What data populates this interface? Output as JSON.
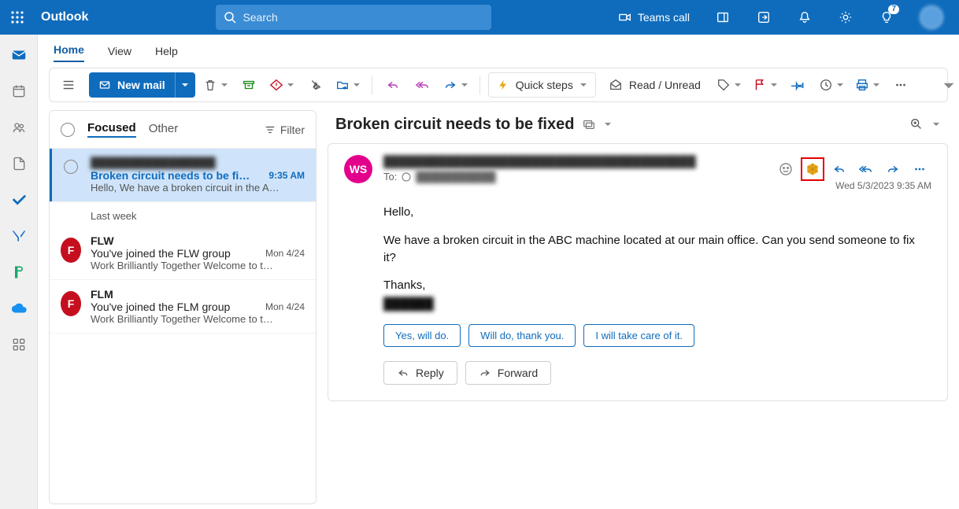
{
  "topbar": {
    "brand": "Outlook",
    "search_placeholder": "Search",
    "teams_call": "Teams call",
    "tip_badge": "7"
  },
  "menutabs": {
    "home": "Home",
    "view": "View",
    "help": "Help"
  },
  "ribbon": {
    "new_mail": "New mail",
    "quick_steps": "Quick steps",
    "read_unread": "Read / Unread"
  },
  "list": {
    "tab_focused": "Focused",
    "tab_other": "Other",
    "filter": "Filter",
    "group_lastweek": "Last week",
    "items": [
      {
        "from": "████████████████",
        "subject": "Broken circuit needs to be fi…",
        "time": "9:35 AM",
        "preview": "Hello, We have a broken circuit in the A…"
      },
      {
        "avatar": "F",
        "from": "FLW",
        "subject": "You've joined the FLW group",
        "time": "Mon 4/24",
        "preview": "Work Brilliantly Together Welcome to t…"
      },
      {
        "avatar": "F",
        "from": "FLM",
        "subject": "You've joined the FLM group",
        "time": "Mon 4/24",
        "preview": "Work Brilliantly Together Welcome to t…"
      }
    ]
  },
  "reading": {
    "subject": "Broken circuit needs to be fixed",
    "avatar_initials": "WS",
    "from_line": "████████████████████████████████████████",
    "to_label": "To:",
    "to_value": "███████████",
    "datetime": "Wed 5/3/2023 9:35 AM",
    "body_p1": "Hello,",
    "body_p2": "We have a broken circuit in the ABC machine located at   our main office. Can you send someone to fix it?",
    "body_p3": "Thanks,",
    "body_sig": "██████",
    "suggest": [
      "Yes, will do.",
      "Will do, thank you.",
      "I will take care of it."
    ],
    "reply": "Reply",
    "forward": "Forward"
  }
}
